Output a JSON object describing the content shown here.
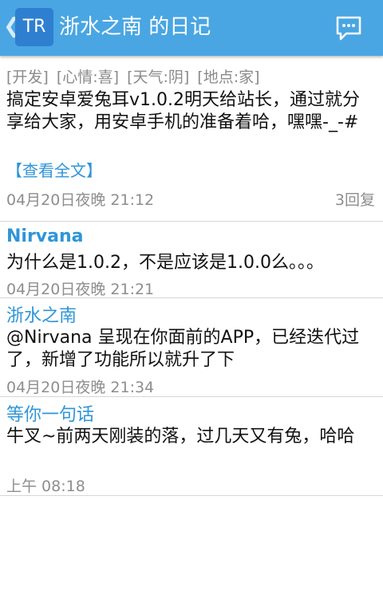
{
  "header": {
    "back_glyph": "❮",
    "avatar_text": "TR",
    "title": "浙水之南 的日记",
    "chat_icon": "chat-icon",
    "bg_color": "#49a6e3"
  },
  "post": {
    "tags": [
      "[开发]",
      "[心情:喜]",
      "[天气:阴]",
      "[地点:家]"
    ],
    "body": "搞定安卓爱兔耳v1.0.2明天给站长，通过就分享给大家，用安卓手机的准备着哈，嘿嘿-_-#",
    "view_full": "【查看全文】",
    "time": "04月20日夜晚  21:12",
    "reply_count": "3回复"
  },
  "replies": [
    {
      "author": "Nirvana",
      "text": "为什么是1.0.2，不是应该是1.0.0么。。。",
      "time": "04月20日夜晚  21:21"
    },
    {
      "author": "浙水之南",
      "text": "@Nirvana 呈现在你面前的APP，已经迭代过了，新增了功能所以就升了下",
      "time": "04月20日夜晚  21:34"
    },
    {
      "author": "等你一句话",
      "text": "牛叉~前两天刚装的落，过几天又有兔，哈哈",
      "time": "上午 08:18"
    }
  ]
}
